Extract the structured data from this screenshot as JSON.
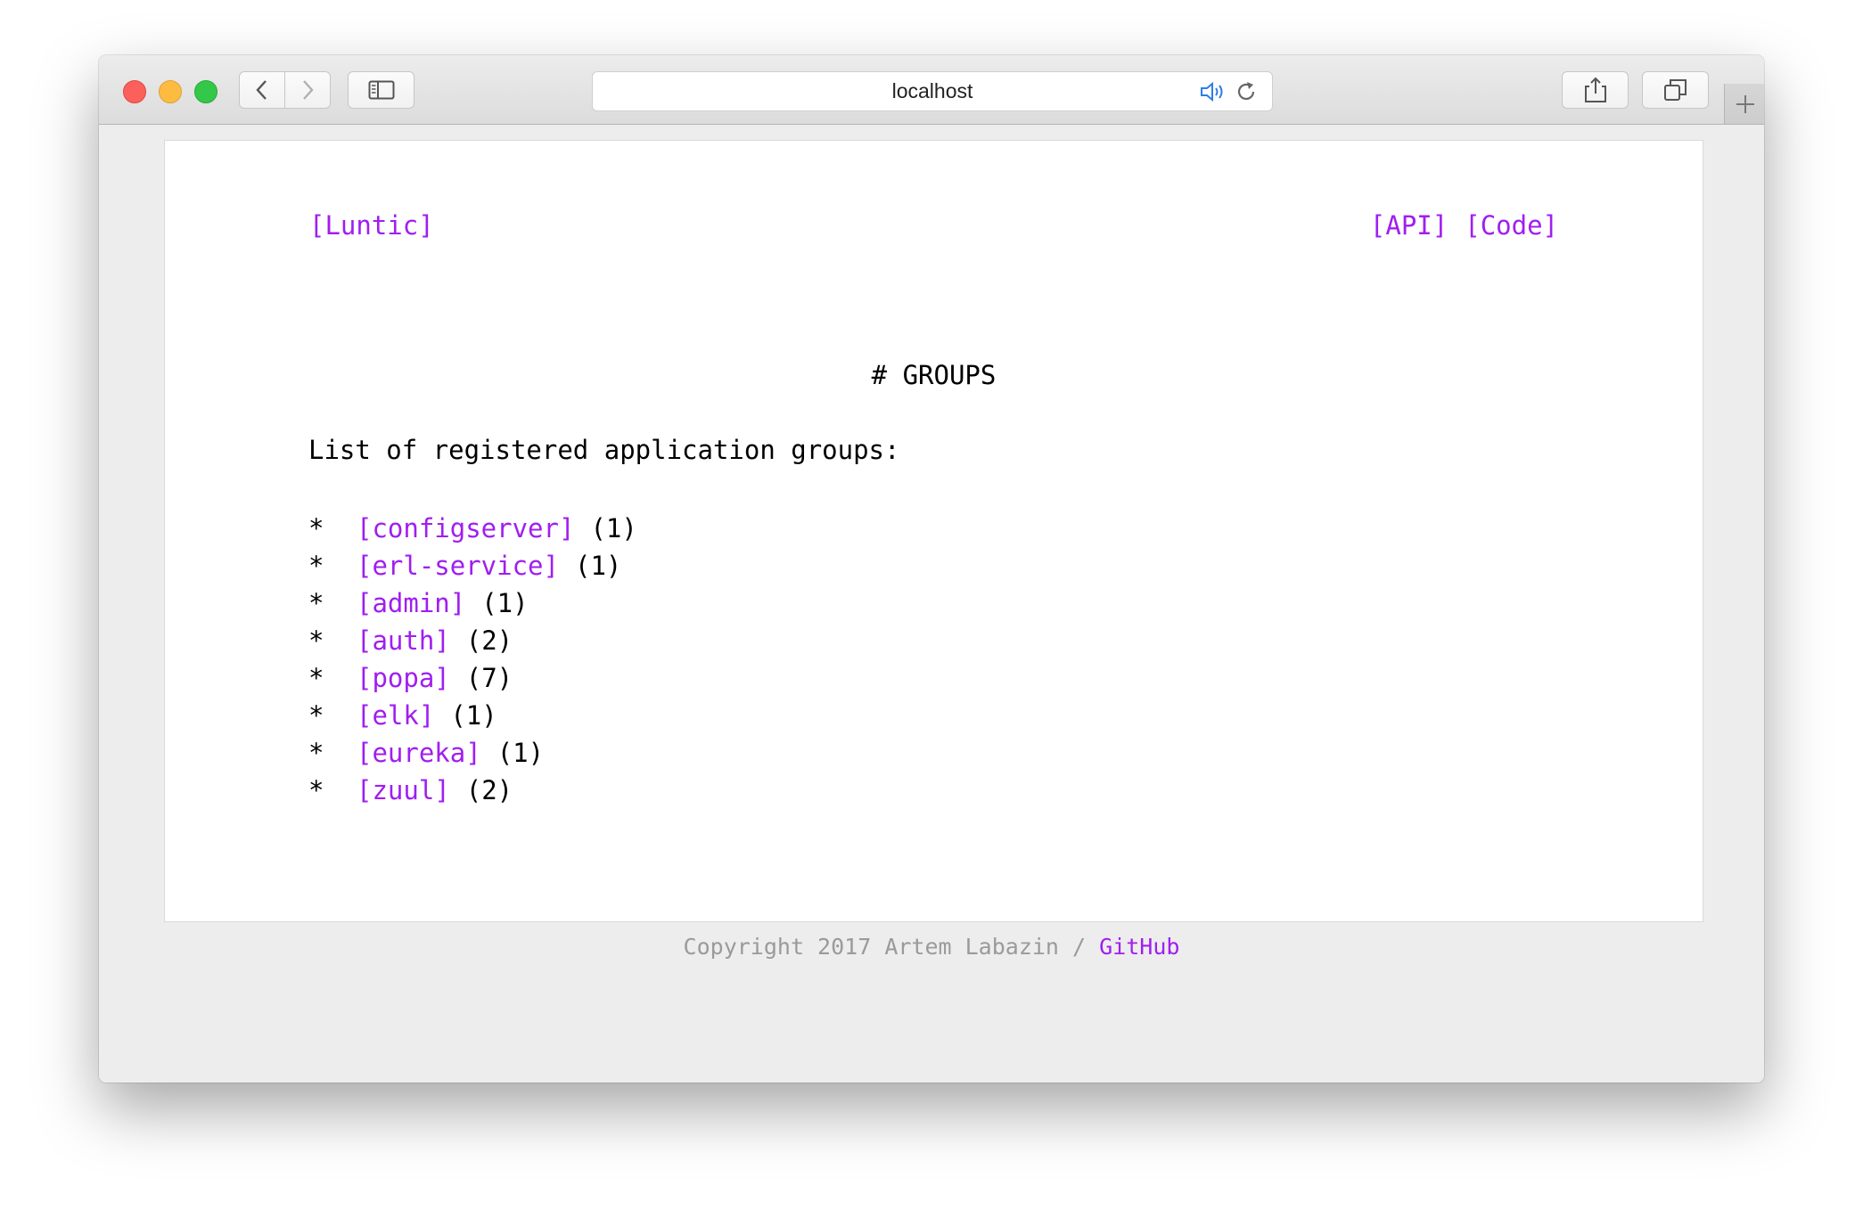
{
  "browser": {
    "url": "localhost",
    "icons": {
      "back": "chevron-left-icon",
      "forward": "chevron-right-icon",
      "sidebar": "sidebar-icon",
      "audio": "speaker-icon",
      "reload": "reload-icon",
      "share": "share-icon",
      "tabs": "tabs-icon",
      "new_tab": "plus-icon"
    },
    "colors": {
      "close": "#fc605b",
      "minimize": "#fdbc40",
      "maximize": "#34c84a"
    }
  },
  "page": {
    "brand": "[Luntic]",
    "nav": [
      "[API]",
      "[Code]"
    ],
    "title": "# GROUPS",
    "intro": "List of registered application groups:",
    "bullet": "*",
    "groups": [
      {
        "name": "[configserver]",
        "count": "(1)"
      },
      {
        "name": "[erl-service]",
        "count": "(1)"
      },
      {
        "name": "[admin]",
        "count": "(1)"
      },
      {
        "name": "[auth]",
        "count": "(2)"
      },
      {
        "name": "[popa]",
        "count": "(7)"
      },
      {
        "name": "[elk]",
        "count": "(1)"
      },
      {
        "name": "[eureka]",
        "count": "(1)"
      },
      {
        "name": "[zuul]",
        "count": "(2)"
      }
    ],
    "link_color": "#a01ef0"
  },
  "footer": {
    "copyright": "Copyright 2017 Artem Labazin / ",
    "github": "GitHub"
  }
}
